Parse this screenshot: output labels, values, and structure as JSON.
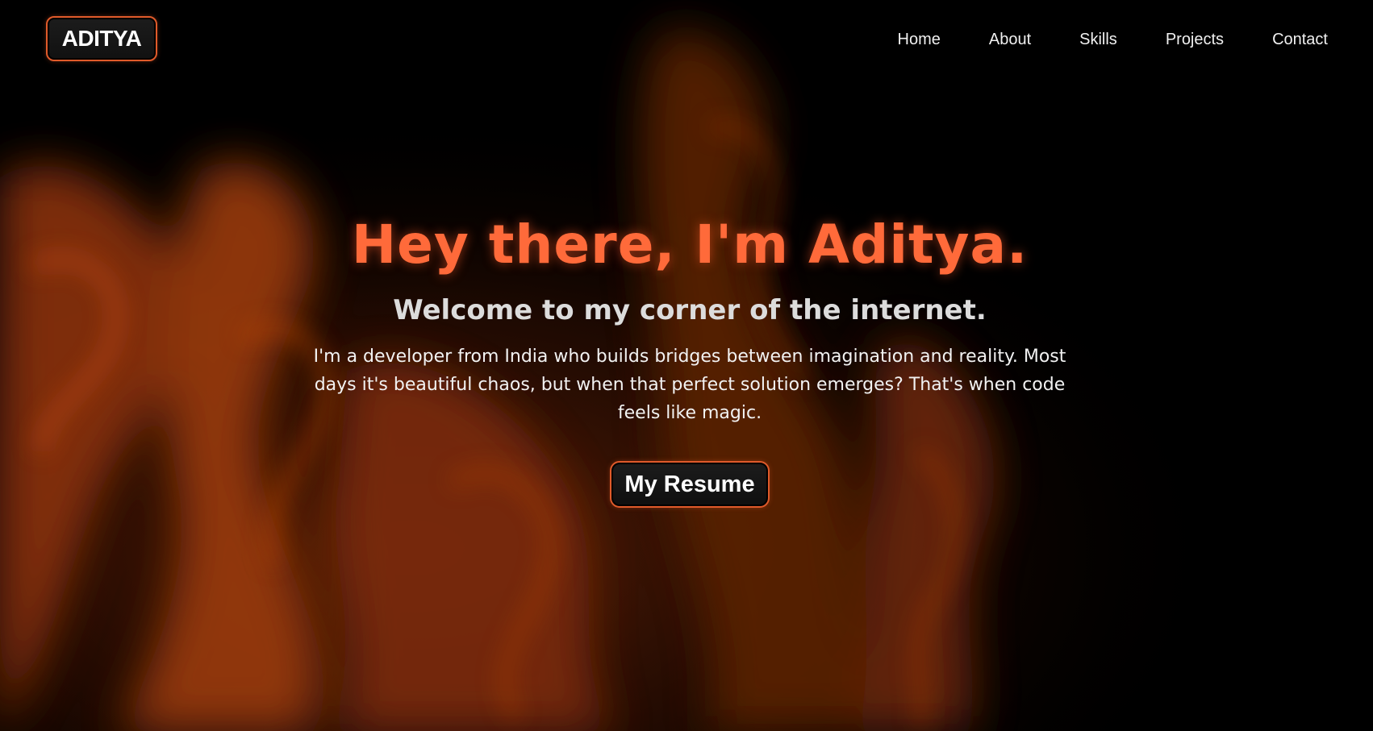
{
  "nav": {
    "logo": "ADITYA",
    "links": [
      "Home",
      "About",
      "Skills",
      "Projects",
      "Contact"
    ]
  },
  "hero": {
    "title": "Hey there, I'm Aditya.",
    "subtitle": "Welcome to my corner of the internet.",
    "description": "I'm a developer from India who builds bridges between imagination and reality. Most days it's beautiful chaos, but when that perfect solution emerges? That's when code feels like magic.",
    "button_label": "My Resume"
  },
  "colors": {
    "accent": "#ff6a3a",
    "border": "#e05a2a",
    "background": "#000000"
  }
}
